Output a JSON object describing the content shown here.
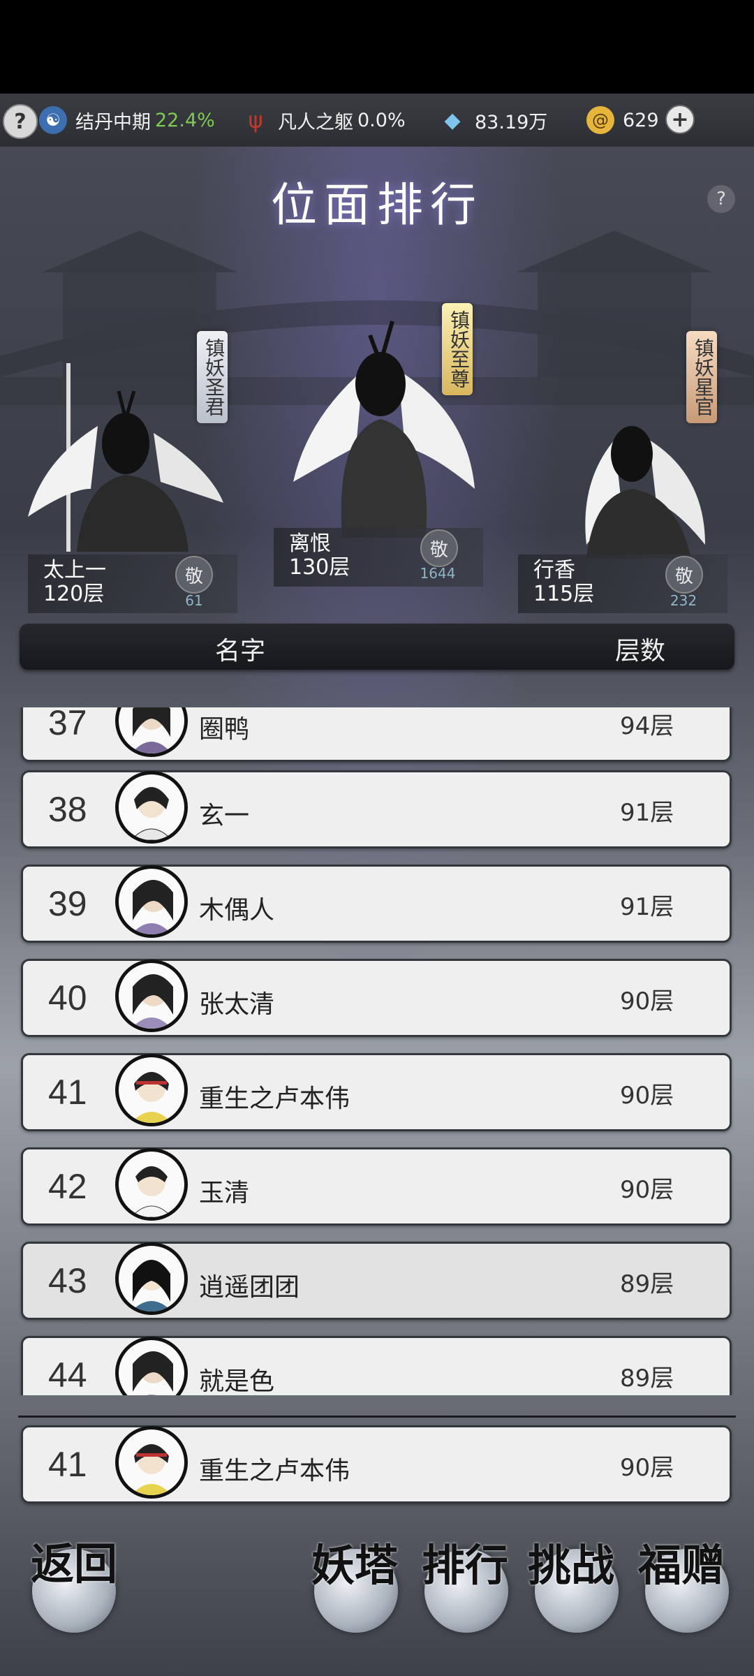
{
  "topbar": {
    "help_icon": "question-mark-icon",
    "cultivation": {
      "icon": "yin-yang-icon",
      "label": "结丹中期",
      "percent": "22.4%"
    },
    "body": {
      "icon": "trident-icon",
      "label": "凡人之躯",
      "percent": "0.0%"
    },
    "crystals": {
      "icon": "crystal-icon",
      "value": "83.19万"
    },
    "coins": {
      "icon": "spiral-coin-icon",
      "value": "629"
    },
    "plus_icon": "plus-icon"
  },
  "page": {
    "title": "位面排行"
  },
  "podium": [
    {
      "tag": "镇妖圣君",
      "name": "太上一",
      "floors": "120层",
      "like_label": "敬",
      "likes": "61"
    },
    {
      "tag": "镇妖至尊",
      "name": "离恨",
      "floors": "130层",
      "like_label": "敬",
      "likes": "1644"
    },
    {
      "tag": "镇妖星官",
      "name": "行香",
      "floors": "115层",
      "like_label": "敬",
      "likes": "232"
    }
  ],
  "table": {
    "col_name": "名字",
    "col_floors": "层数",
    "rows": [
      {
        "rank": "37",
        "name": "圈鸭",
        "floors": "94层"
      },
      {
        "rank": "38",
        "name": "玄一",
        "floors": "91层"
      },
      {
        "rank": "39",
        "name": "木偶人",
        "floors": "91层"
      },
      {
        "rank": "40",
        "name": "张太清",
        "floors": "90层"
      },
      {
        "rank": "41",
        "name": "重生之卢本伟",
        "floors": "90层"
      },
      {
        "rank": "42",
        "name": "玉清",
        "floors": "90层"
      },
      {
        "rank": "43",
        "name": "逍遥团团",
        "floors": "89层"
      },
      {
        "rank": "44",
        "name": "就是色",
        "floors": "89层"
      }
    ]
  },
  "my_rank": {
    "rank": "41",
    "name": "重生之卢本伟",
    "floors": "90层"
  },
  "bottom": {
    "back": "返回",
    "tower": "妖塔",
    "ranking": "排行",
    "challenge": "挑战",
    "gift": "福赠"
  }
}
